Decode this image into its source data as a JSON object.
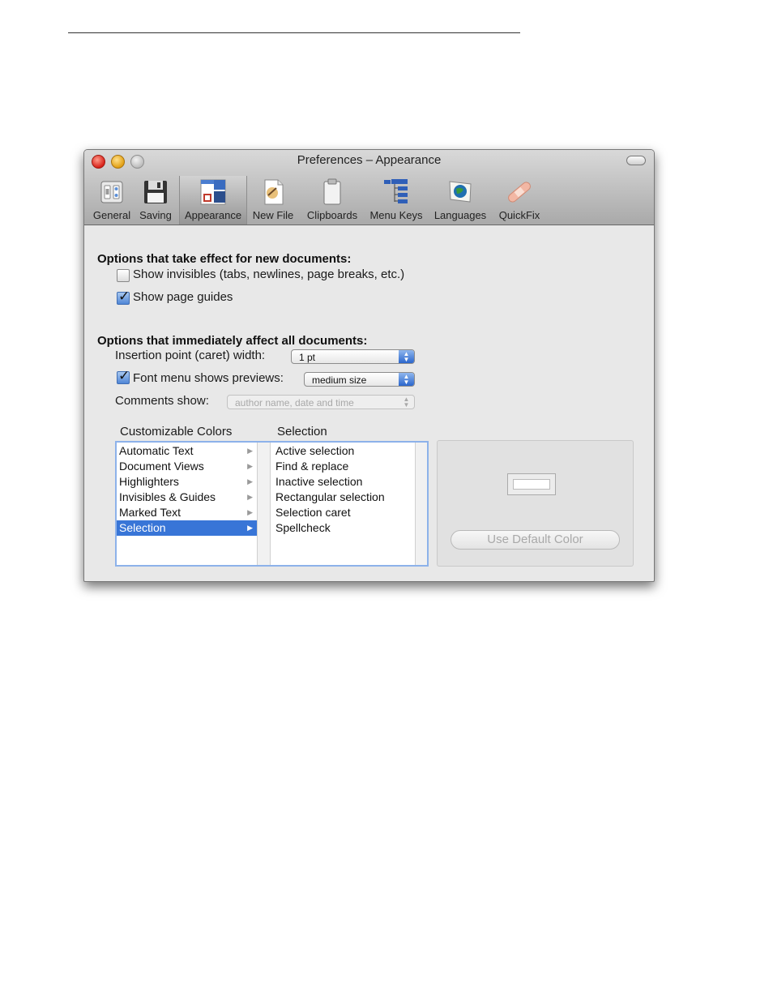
{
  "window": {
    "title": "Preferences – Appearance"
  },
  "toolbar": {
    "items": [
      {
        "label": "General",
        "icon": "switches-icon"
      },
      {
        "label": "Saving",
        "icon": "floppy-disk-icon"
      },
      {
        "label": "Appearance",
        "icon": "appearance-icon",
        "active": true
      },
      {
        "label": "New File",
        "icon": "new-file-icon"
      },
      {
        "label": "Clipboards",
        "icon": "clipboard-icon"
      },
      {
        "label": "Menu Keys",
        "icon": "menu-keys-icon"
      },
      {
        "label": "Languages",
        "icon": "globe-flag-icon"
      },
      {
        "label": "QuickFix",
        "icon": "bandage-icon"
      }
    ]
  },
  "new_docs": {
    "heading": "Options that take effect for new documents:",
    "show_invisibles": {
      "label": "Show invisibles (tabs, newlines, page breaks, etc.)",
      "checked": false
    },
    "show_page_guides": {
      "label": "Show page guides",
      "checked": true
    }
  },
  "all_docs": {
    "heading": "Options that immediately affect all documents:",
    "caret_width": {
      "label": "Insertion point (caret) width:",
      "value": "1 pt"
    },
    "font_previews": {
      "label": "Font menu shows previews:",
      "value": "medium size",
      "checked": true
    },
    "comments": {
      "label": "Comments show:",
      "value": "author name, date and time",
      "enabled": false
    }
  },
  "colors": {
    "header1": "Customizable Colors",
    "header2": "Selection",
    "categories": [
      "Automatic Text",
      "Document Views",
      "Highlighters",
      "Invisibles & Guides",
      "Marked Text",
      "Selection"
    ],
    "selected_category": "Selection",
    "items": [
      "Active selection",
      "Find & replace",
      "Inactive selection",
      "Rectangular selection",
      "Selection caret",
      "Spellcheck"
    ],
    "default_button": "Use Default Color"
  },
  "colors_hex": {
    "selection_highlight": "#3875d7",
    "focus_ring": "#8db2ea"
  }
}
